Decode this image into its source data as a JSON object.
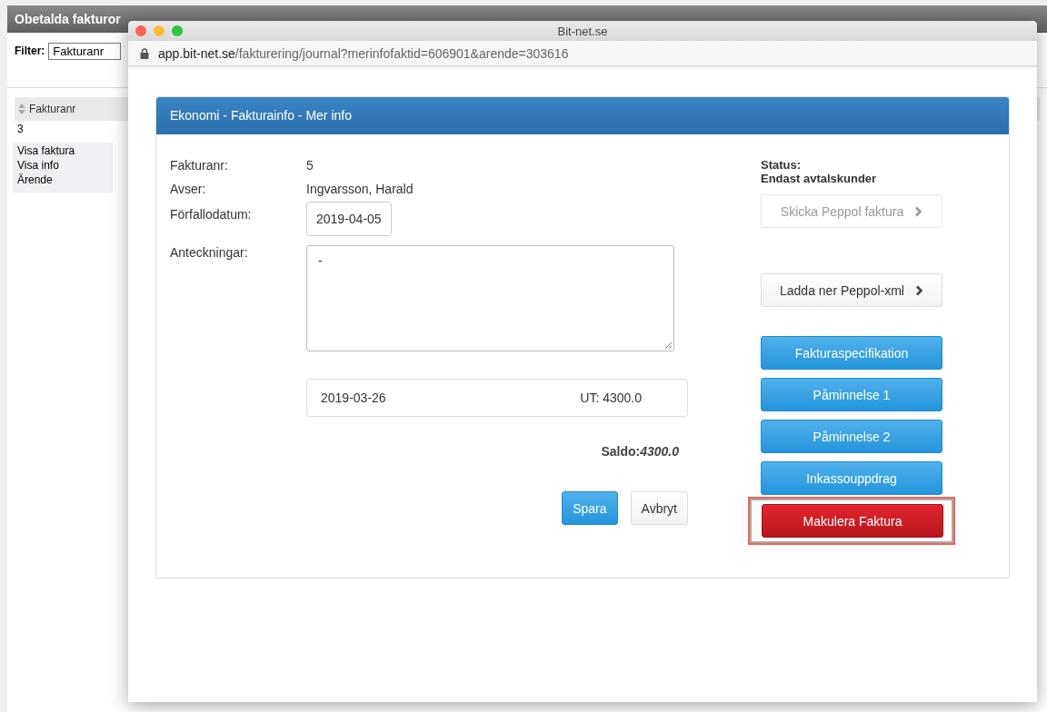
{
  "background_page": {
    "title": "Obetalda fakturor",
    "filter_label": "Filter:",
    "filter_value": "Fakturanr",
    "table": {
      "columns": [
        "Fakturanr"
      ],
      "rows": [
        "3"
      ]
    },
    "context_menu": [
      "Visa faktura",
      "Visa info",
      "Ärende"
    ]
  },
  "browser_window": {
    "title": "Bit-net.se",
    "url_host": "app.bit-net.se",
    "url_path": "/fakturering/journal?merinfofaktid=606901&arende=303616"
  },
  "panel": {
    "title": "Ekonomi - Fakturainfo - Mer info",
    "fields": [
      {
        "label": "Fakturanr:",
        "kind": "text",
        "value": "5"
      },
      {
        "label": "Avser:",
        "kind": "text",
        "value": "Ingvarsson, Harald"
      },
      {
        "label": "Förfallodatum:",
        "kind": "input",
        "value": "2019-04-05"
      },
      {
        "label": "Anteckningar:",
        "kind": "textarea",
        "value": "-"
      }
    ],
    "transaction": {
      "date": "2019-03-26",
      "amount": "UT: 4300.0"
    },
    "balance": "Saldo:*4300.0*",
    "form_buttons": [
      {
        "label": "Spara",
        "kind": "primary"
      },
      {
        "label": "Avbryt",
        "kind": "default"
      }
    ],
    "status_label": "Status:",
    "status_value": "Endast avtalskunder",
    "actions": [
      {
        "label": "Skicka Peppol faktura",
        "kind": "default",
        "disabled": true,
        "chevron": true,
        "highlighted": false
      },
      {
        "label": "Ladda ner Peppol-xml",
        "kind": "default",
        "disabled": false,
        "chevron": true,
        "highlighted": false
      },
      {
        "label": "Fakturaspecifikation",
        "kind": "primary",
        "disabled": false,
        "chevron": false,
        "highlighted": false
      },
      {
        "label": "Påminnelse 1",
        "kind": "primary",
        "disabled": false,
        "chevron": false,
        "highlighted": false
      },
      {
        "label": "Påminnelse 2",
        "kind": "primary",
        "disabled": false,
        "chevron": false,
        "highlighted": false
      },
      {
        "label": "Inkassouppdrag",
        "kind": "primary",
        "disabled": false,
        "chevron": false,
        "highlighted": false
      },
      {
        "label": "Makulera Faktura",
        "kind": "danger",
        "disabled": false,
        "chevron": false,
        "highlighted": true
      }
    ]
  }
}
